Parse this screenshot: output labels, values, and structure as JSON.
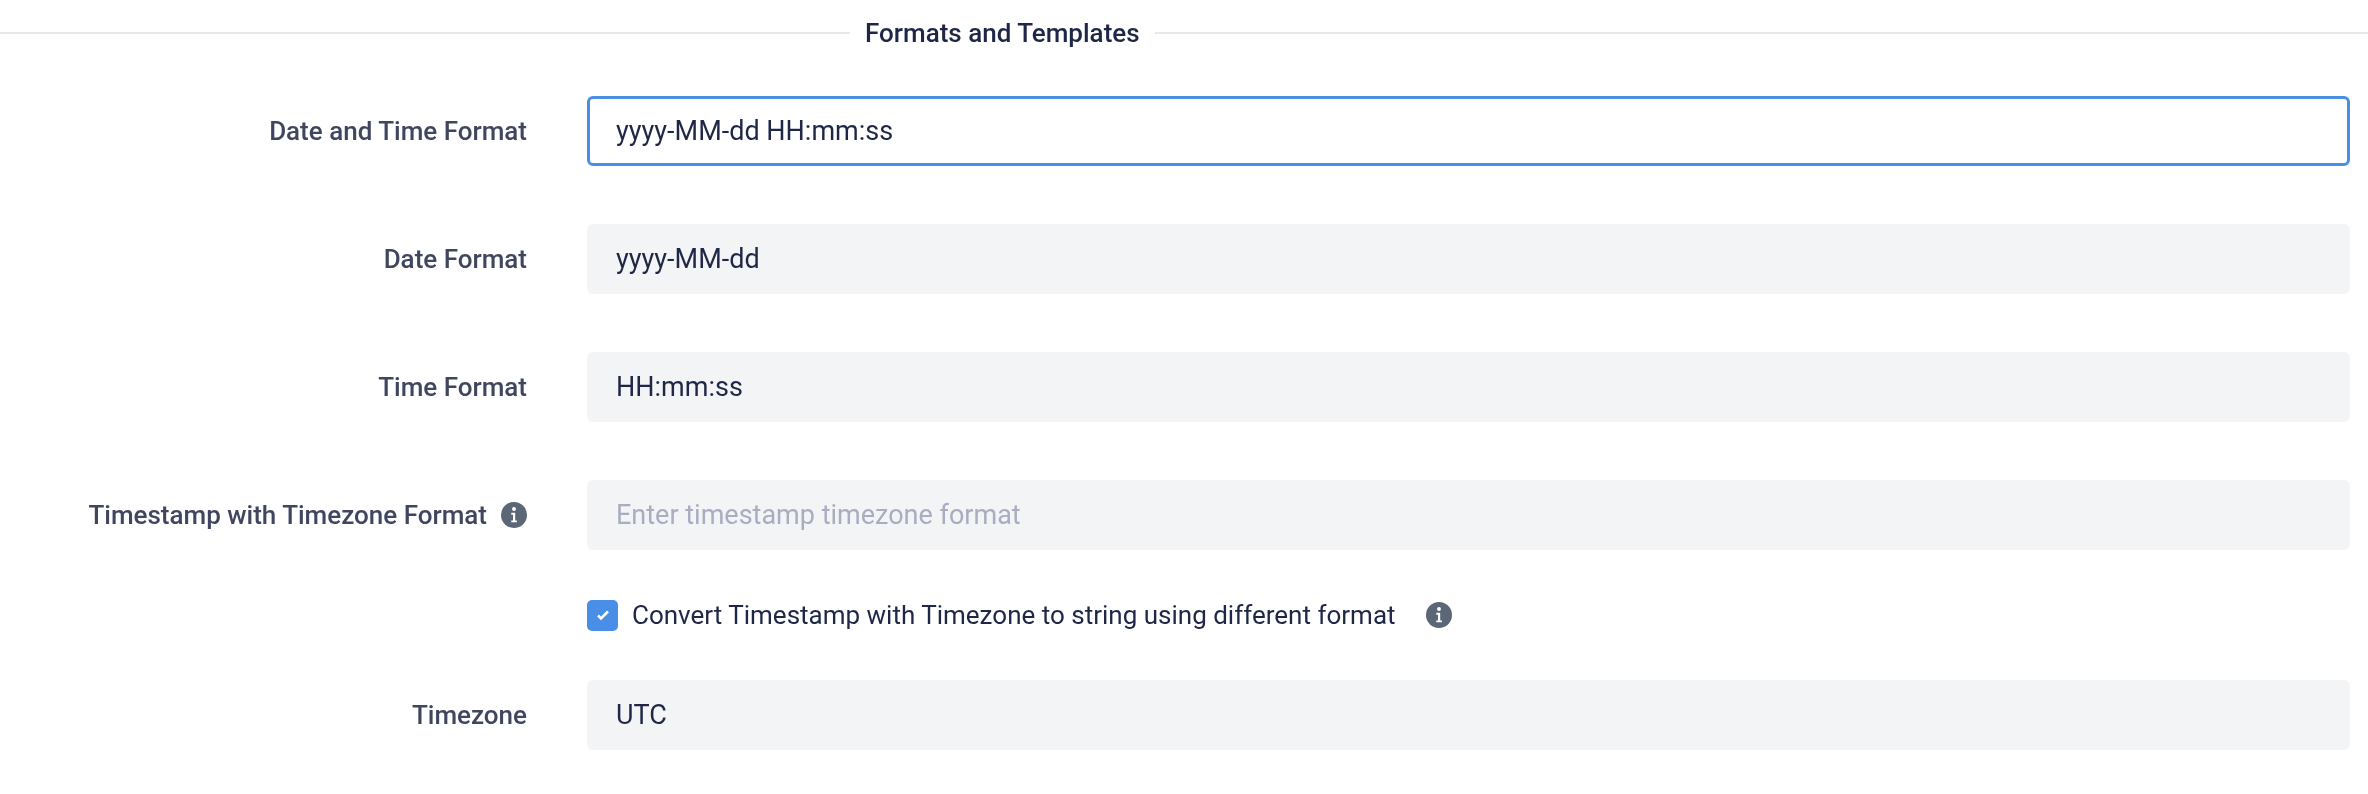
{
  "section": {
    "title": "Formats and Templates"
  },
  "rows": [
    {
      "kind": "input",
      "label": "Date and Time Format",
      "value": "yyyy-MM-dd HH:mm:ss",
      "focused": true,
      "info": false
    },
    {
      "kind": "input",
      "label": "Date Format",
      "value": "yyyy-MM-dd",
      "focused": false,
      "info": false
    },
    {
      "kind": "input",
      "label": "Time Format",
      "value": "HH:mm:ss",
      "focused": false,
      "info": false
    },
    {
      "kind": "input",
      "label": "Timestamp with Timezone Format",
      "placeholder": "Enter timestamp timezone format",
      "focused": false,
      "info": true
    },
    {
      "kind": "checkbox",
      "label": "Convert Timestamp with Timezone to string using different format",
      "checked": true,
      "info": true
    },
    {
      "kind": "input",
      "label": "Timezone",
      "value": "UTC",
      "focused": false,
      "info": false
    }
  ]
}
